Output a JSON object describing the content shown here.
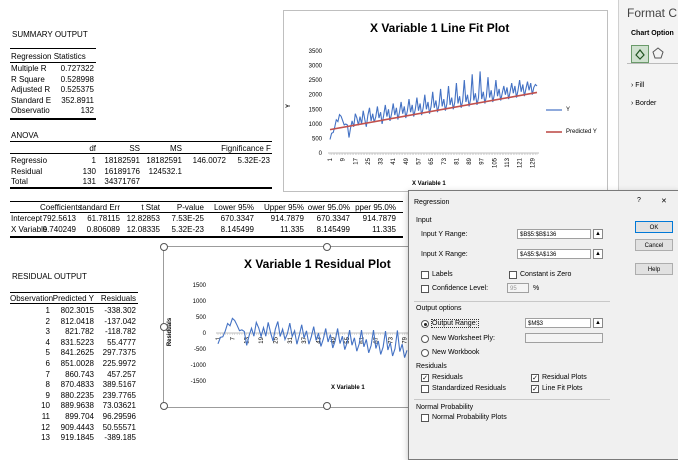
{
  "summary": {
    "title": "SUMMARY OUTPUT",
    "reg_stats_header": "Regression Statistics",
    "stats": [
      {
        "label": "Multiple R",
        "value": "0.727322"
      },
      {
        "label": "R Square",
        "value": "0.528998"
      },
      {
        "label": "Adjusted R",
        "value": "0.525375"
      },
      {
        "label": "Standard E",
        "value": "352.8911"
      },
      {
        "label": "Observatio",
        "value": "132"
      }
    ]
  },
  "anova": {
    "title": "ANOVA",
    "headers": [
      "df",
      "SS",
      "MS",
      "F",
      "ignificance F"
    ],
    "rows": [
      {
        "label": "Regressio",
        "cells": [
          "1",
          "18182591",
          "18182591",
          "146.0072",
          "5.32E-23"
        ]
      },
      {
        "label": "Residual",
        "cells": [
          "130",
          "16189176",
          "124532.1",
          "",
          ""
        ]
      },
      {
        "label": "Total",
        "cells": [
          "131",
          "34371767",
          "",
          "",
          ""
        ]
      }
    ]
  },
  "coef": {
    "headers": [
      "Coefficients",
      "tandard Err",
      "t Stat",
      "P-value",
      "Lower 95%",
      "Upper 95%",
      "ower 95.0%",
      "pper 95.0%"
    ],
    "rows": [
      {
        "label": "Intercept",
        "cells": [
          "792.5613",
          "61.78115",
          "12.82853",
          "7.53E-25",
          "670.3347",
          "914.7879",
          "670.3347",
          "914.7879"
        ]
      },
      {
        "label": "X Variable",
        "cells": [
          "9.740249",
          "0.806089",
          "12.08335",
          "5.32E-23",
          "8.145499",
          "11.335",
          "8.145499",
          "11.335"
        ]
      }
    ]
  },
  "residual": {
    "title": "RESIDUAL OUTPUT",
    "headers": [
      "Observation",
      "Predicted Y",
      "Residuals"
    ],
    "rows": [
      [
        "1",
        "802.3015",
        "-338.302"
      ],
      [
        "2",
        "812.0418",
        "-137.042"
      ],
      [
        "3",
        "821.782",
        "-118.782"
      ],
      [
        "4",
        "831.5223",
        "55.4777"
      ],
      [
        "5",
        "841.2625",
        "297.7375"
      ],
      [
        "6",
        "851.0028",
        "225.9972"
      ],
      [
        "7",
        "860.743",
        "457.257"
      ],
      [
        "8",
        "870.4833",
        "389.5167"
      ],
      [
        "9",
        "880.2235",
        "239.7765"
      ],
      [
        "10",
        "889.9638",
        "73.03621"
      ],
      [
        "11",
        "899.704",
        "96.29596"
      ],
      [
        "12",
        "909.4443",
        "50.55571"
      ],
      [
        "13",
        "919.1845",
        "-389.185"
      ]
    ]
  },
  "chart_data": [
    {
      "type": "line",
      "title": "X Variable 1 Line Fit  Plot",
      "xlabel": "X Variable 1",
      "ylabel": "Y",
      "ylim": [
        0,
        3500
      ],
      "yticks": [
        "3500",
        "3000",
        "2500",
        "2000",
        "1500",
        "1000",
        "500",
        "0"
      ],
      "xticks": [
        "1",
        "9",
        "17",
        "25",
        "33",
        "41",
        "49",
        "57",
        "65",
        "73",
        "81",
        "89",
        "97",
        "105",
        "113",
        "121",
        "129"
      ],
      "legend_position": "right",
      "series": [
        {
          "name": "Y",
          "color": "#4472c4",
          "values": [
            464,
            675,
            703,
            887,
            1139,
            1077,
            1318,
            1260,
            1120,
            963,
            996,
            960,
            530,
            850,
            1100,
            900,
            1350,
            1200,
            950,
            1250,
            1000,
            1450,
            1150,
            900,
            1300,
            1550,
            1100,
            1350,
            1050,
            1250,
            1600,
            1200,
            1400,
            1000,
            1300,
            1650,
            1250,
            1500,
            1100,
            1350,
            1700,
            1300,
            1550,
            1150,
            1400,
            1750,
            1350,
            1600,
            1200,
            1450,
            1850,
            1400,
            1650,
            1250,
            1500,
            1900,
            1450,
            1700,
            1300,
            1550,
            2000,
            1500,
            1750,
            1350,
            1600,
            2100,
            1550,
            1800,
            1400,
            1650,
            2200,
            1600,
            1850,
            1450,
            1700,
            2300,
            1650,
            1900,
            1500,
            1750,
            2400,
            1700,
            1950,
            1550,
            1800,
            2500,
            1750,
            2000,
            1600,
            1850,
            2700,
            1800,
            2050,
            1650,
            1900,
            2800,
            1850,
            2100,
            1700,
            1950,
            2600,
            1900,
            2150,
            1750,
            2000,
            2500,
            1950,
            2200,
            1800,
            2050,
            2300,
            2000,
            2250,
            1850,
            2100,
            2400,
            2050,
            2300,
            1900,
            2150,
            2500,
            2100,
            2350,
            1950,
            2200,
            2450,
            2150,
            2400,
            2000,
            2250,
            2350,
            2300
          ]
        },
        {
          "name": "Predicted Y",
          "color": "#c0504d",
          "values": [
            802.3,
            2078.3
          ]
        }
      ]
    },
    {
      "type": "scatter",
      "title": "X Variable 1  Residual Plot",
      "xlabel": "X Variable 1",
      "ylabel": "Residuals",
      "ylim": [
        -1500,
        1500
      ],
      "yticks": [
        "1500",
        "1000",
        "500",
        "0",
        "-500",
        "-1000",
        "-1500"
      ],
      "xticks": [
        "1",
        "7",
        "13",
        "19",
        "25",
        "31",
        "37",
        "43",
        "49",
        "55",
        "61",
        "67",
        "73",
        "79"
      ],
      "series": [
        {
          "name": "",
          "color": "#4472c4",
          "values": [
            -338,
            -137,
            -119,
            55,
            298,
            226,
            457,
            390,
            240,
            73,
            96,
            51,
            -389,
            -80,
            150,
            -100,
            330,
            160,
            -110,
            170,
            -100,
            330,
            10,
            -250,
            130,
            360,
            -110,
            120,
            -200,
            -20,
            310,
            -110,
            70,
            -350,
            -70,
            260,
            -160,
            70,
            -350,
            -120,
            200,
            -230,
            0,
            -420,
            -190,
            140,
            -280,
            -50,
            -470,
            -240,
            140,
            -330,
            -100,
            -520,
            -290,
            90,
            -380,
            -150,
            -570,
            -340,
            90,
            -430,
            -200,
            -620,
            -390,
            90,
            -480,
            -250,
            -670,
            -440,
            60,
            -530,
            -300,
            -720,
            -490,
            80,
            -580,
            -350,
            -770,
            -540
          ]
        }
      ]
    }
  ],
  "pane": {
    "title": "Format C",
    "subtitle": "Chart Option",
    "items": [
      "Fill",
      "Border"
    ]
  },
  "dialog": {
    "title": "Regression",
    "help_glyph": "?",
    "close_glyph": "✕",
    "input_section": "Input",
    "input_y_label": "Input Y Range:",
    "input_y_value": "$B$5:$B$136",
    "input_x_label": "Input X Range:",
    "input_x_value": "$A$5:$A$136",
    "labels": "Labels",
    "constant_zero": "Constant is Zero",
    "confidence": "Confidence Level:",
    "confidence_value": "95",
    "percent": "%",
    "output_section": "Output options",
    "output_range": "Output Range:",
    "output_range_value": "$M$3",
    "new_ply": "New Worksheet Ply:",
    "new_workbook": "New Workbook",
    "residuals_section": "Residuals",
    "residuals": "Residuals",
    "std_residuals": "Standardized Residuals",
    "residual_plots": "Residual Plots",
    "line_fit": "Line Fit Plots",
    "normal_section": "Normal Probability",
    "normal_plots": "Normal Probability Plots",
    "ok": "OK",
    "cancel": "Cancel",
    "help": "Help"
  }
}
